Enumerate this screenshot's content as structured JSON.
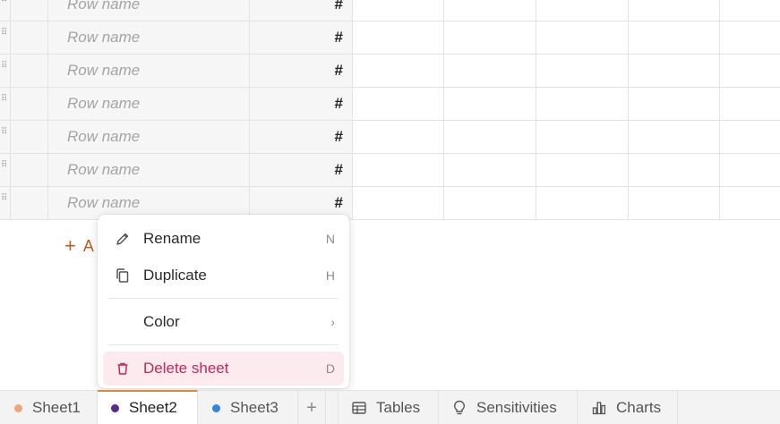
{
  "grid": {
    "rows": [
      {
        "name_placeholder": "Row name",
        "type": "#"
      },
      {
        "name_placeholder": "Row name",
        "type": "#"
      },
      {
        "name_placeholder": "Row name",
        "type": "#"
      },
      {
        "name_placeholder": "Row name",
        "type": "#"
      },
      {
        "name_placeholder": "Row name",
        "type": "#"
      },
      {
        "name_placeholder": "Row name",
        "type": "#"
      },
      {
        "name_placeholder": "Row name",
        "type": "#"
      }
    ],
    "add_row_label": "A"
  },
  "context_menu": {
    "items": [
      {
        "label": "Rename",
        "shortcut": "N",
        "icon": "pencil-icon"
      },
      {
        "label": "Duplicate",
        "shortcut": "H",
        "icon": "copy-icon"
      },
      {
        "label": "Color",
        "shortcut": "›",
        "icon": "chevron-right-icon"
      },
      {
        "label": "Delete sheet",
        "shortcut": "D",
        "icon": "trash-icon"
      }
    ]
  },
  "tabs": {
    "sheets": [
      {
        "label": "Sheet1",
        "color": "#f0a47a"
      },
      {
        "label": "Sheet2",
        "color": "#5b2a86"
      },
      {
        "label": "Sheet3",
        "color": "#2f86e8"
      }
    ],
    "add_label": "+",
    "views": [
      {
        "label": "Tables",
        "icon": "table-icon"
      },
      {
        "label": "Sensitivities",
        "icon": "lightbulb-icon"
      },
      {
        "label": "Charts",
        "icon": "bar-chart-icon"
      }
    ],
    "active_accent": "#e0893c"
  },
  "colors": {
    "add_accent": "#c25a1e",
    "delete_color": "#c2285a"
  }
}
